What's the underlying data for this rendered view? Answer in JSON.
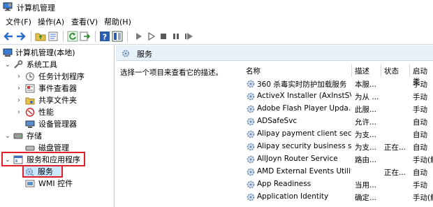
{
  "window": {
    "title": "计算机管理"
  },
  "menu": [
    "文件(F)",
    "操作(A)",
    "查看(V)",
    "帮助(H)"
  ],
  "toolbar_icons": [
    "back-arrow-icon",
    "forward-arrow-icon",
    "folder-up-icon",
    "properties-icon",
    "refresh-icon",
    "export-icon",
    "help-icon",
    "show-hide-icon",
    "play-icon",
    "play-outline-icon",
    "stop-icon",
    "pause-icon",
    "restart-icon"
  ],
  "tree": {
    "root": "计算机管理(本地)",
    "system_tools": "系统工具",
    "task_scheduler": "任务计划程序",
    "event_viewer": "事件查看器",
    "shared_folders": "共享文件夹",
    "performance": "性能",
    "device_manager": "设备管理器",
    "storage": "存储",
    "disk_management": "磁盘管理",
    "services_apps": "服务和应用程序",
    "services": "服务",
    "wmi": "WMI 控件"
  },
  "pane": {
    "title": "服务",
    "description": "选择一个项目来查看它的描述。",
    "columns": {
      "name": "名称",
      "desc": "描述",
      "status": "状态",
      "startup": "启动类"
    }
  },
  "services": [
    {
      "name": "360 杀毒实时防护加载服务",
      "desc": "本服...",
      "status": "",
      "startup": "手动"
    },
    {
      "name": "ActiveX Installer (AxInstSV)",
      "desc": "为从 ...",
      "status": "",
      "startup": "手动"
    },
    {
      "name": "Adobe Flash Player Upda...",
      "desc": "此服...",
      "status": "",
      "startup": "手动"
    },
    {
      "name": "ADSafeSvc",
      "desc": "允许...",
      "status": "",
      "startup": "自动"
    },
    {
      "name": "Alipay payment client sec...",
      "desc": "为支...",
      "status": "",
      "startup": "自动"
    },
    {
      "name": "Alipay security business s...",
      "desc": "为支...",
      "status": "正在...",
      "startup": "自动"
    },
    {
      "name": "AllJoyn Router Service",
      "desc": "路由...",
      "status": "",
      "startup": "手动(触"
    },
    {
      "name": "AMD External Events Utility",
      "desc": "",
      "status": "正在...",
      "startup": "自动"
    },
    {
      "name": "App Readiness",
      "desc": "当用...",
      "status": "",
      "startup": "手动"
    },
    {
      "name": "Application Identity",
      "desc": "确定...",
      "status": "",
      "startup": "手动(触"
    }
  ],
  "colors": {
    "selection": "#cce8ff",
    "highlight_box": "#e0202a",
    "header_bg": "#e8f0f8"
  }
}
